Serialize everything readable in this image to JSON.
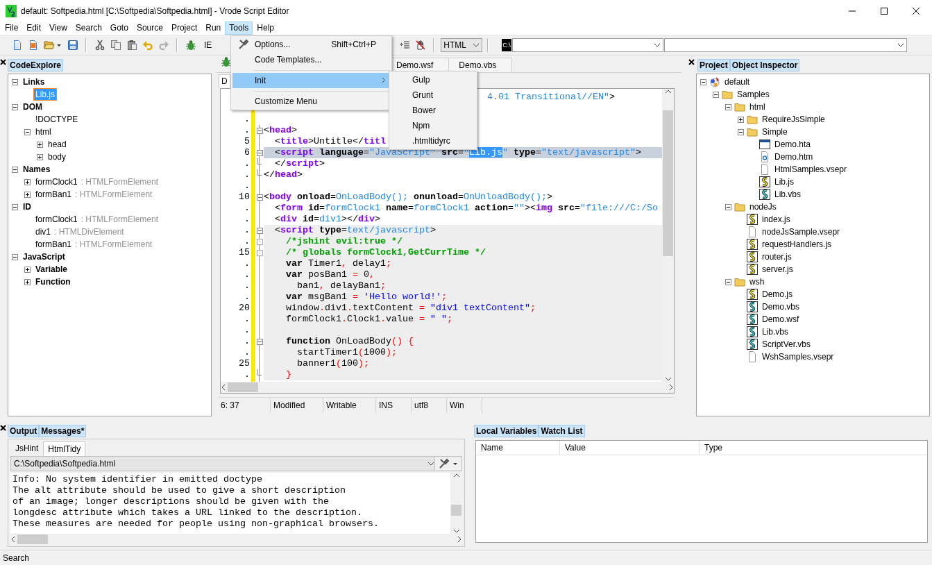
{
  "window": {
    "title": "default: Softpedia.html [C:\\Softpedia\\Softpedia.html] - Vrode Script Editor"
  },
  "menu_bar": [
    {
      "label": "File",
      "selected": false
    },
    {
      "label": "Edit",
      "selected": false
    },
    {
      "label": "View",
      "selected": false
    },
    {
      "label": "Search",
      "selected": false
    },
    {
      "label": "Goto",
      "selected": false
    },
    {
      "label": "Source",
      "selected": false
    },
    {
      "label": "Project",
      "selected": false
    },
    {
      "label": "Run",
      "selected": false
    },
    {
      "label": "Tools",
      "selected": true
    },
    {
      "label": "Help",
      "selected": false
    }
  ],
  "toolbar": {
    "buttons": [
      {
        "kind": "new"
      },
      {
        "kind": "template"
      },
      {
        "kind": "open",
        "dropdown": true
      },
      {
        "kind": "save"
      },
      {
        "kind": "separator"
      },
      {
        "kind": "cut"
      },
      {
        "kind": "copy"
      },
      {
        "kind": "paste"
      },
      {
        "kind": "undo",
        "disabled": false
      },
      {
        "kind": "redo",
        "disabled": true
      },
      {
        "kind": "separator"
      },
      {
        "kind": "debug"
      },
      {
        "kind": "label",
        "text": "IE"
      }
    ],
    "buttons_after_menu": [
      {
        "kind": "lines"
      },
      {
        "kind": "stop"
      },
      {
        "kind": "separator"
      }
    ],
    "language": "HTML",
    "console_label": "C:\\"
  },
  "tools_menu": {
    "items": [
      {
        "kind": "item",
        "label": "Options...",
        "shortcut": "Shift+Ctrl+P",
        "selected": false
      },
      {
        "kind": "item",
        "label": "Code Templates...",
        "selected": false
      },
      {
        "kind": "separator"
      },
      {
        "kind": "submenu",
        "label": "Init",
        "selected": true
      },
      {
        "kind": "separator"
      },
      {
        "kind": "item",
        "label": "Customize Menu",
        "selected": false
      }
    ],
    "submenu": [
      "Gulp",
      "Grunt",
      "Bower",
      "Npm",
      ".htmltidyrc"
    ]
  },
  "code_explorer": {
    "tab": "CodeExplore",
    "tree": [
      {
        "label": "Links",
        "bold": true,
        "expanded": true,
        "selected": false,
        "children": [
          {
            "label": "Lib.js",
            "bold": false,
            "selected": true
          }
        ]
      },
      {
        "label": "DOM",
        "bold": true,
        "expanded": true,
        "selected": false,
        "children": [
          {
            "label": "!DOCTYPE",
            "bold": false,
            "selected": false
          },
          {
            "label": "html",
            "bold": false,
            "expanded": true,
            "selected": false,
            "children": [
              {
                "label": "head",
                "bold": false,
                "expanded": false,
                "selected": false
              },
              {
                "label": "body",
                "bold": false,
                "expanded": false,
                "selected": false
              }
            ]
          }
        ]
      },
      {
        "label": "Names",
        "bold": true,
        "expanded": true,
        "selected": false,
        "children": [
          {
            "label": "formClock1",
            "type": ": HTMLFormElement",
            "bold": false,
            "expanded": false,
            "selected": false
          },
          {
            "label": "formBan1",
            "type": ": HTMLFormElement",
            "bold": false,
            "expanded": false,
            "selected": false
          }
        ]
      },
      {
        "label": "ID",
        "bold": true,
        "expanded": true,
        "selected": false,
        "children": [
          {
            "label": "formClock1",
            "type": ": HTMLFormElement",
            "bold": false,
            "selected": false
          },
          {
            "label": "div1",
            "type": ": HTMLDivElement",
            "bold": false,
            "selected": false
          },
          {
            "label": "formBan1",
            "type": ": HTMLFormElement",
            "bold": false,
            "selected": false
          }
        ]
      },
      {
        "label": "JavaScript",
        "bold": true,
        "expanded": true,
        "selected": false,
        "children": [
          {
            "label": "Variable",
            "bold": true,
            "expanded": false,
            "selected": false
          },
          {
            "label": "Function",
            "bold": true,
            "expanded": false,
            "selected": false
          }
        ]
      }
    ]
  },
  "editor": {
    "tabs": [
      {
        "label": "Demo.wsf"
      },
      {
        "label": "Demo.vbs"
      }
    ],
    "inner_tab": "D",
    "lines": [
      {
        "kind": "plain",
        "covered": true,
        "tokens": [
          {
            "kind": "value",
            "text": "4.01 Transitional//EN\""
          },
          {
            "kind": "punct",
            "text": ">"
          }
        ]
      },
      {
        "kind": "plain"
      },
      {
        "num": ".",
        "kind": "plain"
      },
      {
        "num": ".",
        "kind": "fold",
        "tokens": [
          {
            "kind": "punct",
            "text": "<"
          },
          {
            "kind": "tag",
            "text": "head"
          },
          {
            "kind": "punct",
            "text": ">"
          }
        ]
      },
      {
        "num": "5",
        "kind": "plain",
        "tokens": [
          {
            "kind": "punct",
            "text": "  <"
          },
          {
            "kind": "tag",
            "text": "title"
          },
          {
            "kind": "punct",
            "text": ">"
          },
          {
            "kind": "text",
            "text": "Untitle"
          },
          {
            "kind": "punct",
            "text": "</"
          },
          {
            "kind": "tag",
            "text": "titl"
          }
        ]
      },
      {
        "num": "6",
        "kind": "fold",
        "current": true,
        "tokens": [
          {
            "kind": "punct",
            "text": "  <"
          },
          {
            "kind": "tag",
            "text": "script"
          },
          {
            "kind": "attr",
            "text": " language"
          },
          {
            "kind": "punct",
            "text": "="
          },
          {
            "kind": "value",
            "text": "\"JavaScript\""
          },
          {
            "kind": "attr",
            "text": " src"
          },
          {
            "kind": "punct",
            "text": "="
          },
          {
            "kind": "value",
            "text": "\""
          },
          {
            "kind": "sel",
            "text": "Lib.js"
          },
          {
            "kind": "value",
            "text": "\""
          },
          {
            "kind": "attr",
            "text": " type"
          },
          {
            "kind": "punct",
            "text": "="
          },
          {
            "kind": "value",
            "text": "\"text/javascript\""
          },
          {
            "kind": "punct",
            "text": ">"
          }
        ]
      },
      {
        "num": ".",
        "kind": "end",
        "tokens": [
          {
            "kind": "punct",
            "text": "  </"
          },
          {
            "kind": "tag",
            "text": "script"
          },
          {
            "kind": "punct",
            "text": ">"
          }
        ]
      },
      {
        "num": ".",
        "kind": "end",
        "tokens": [
          {
            "kind": "punct",
            "text": "</"
          },
          {
            "kind": "tag",
            "text": "head"
          },
          {
            "kind": "punct",
            "text": ">"
          }
        ]
      },
      {
        "num": ".",
        "kind": "plain"
      },
      {
        "num": "10",
        "kind": "fold",
        "tokens": [
          {
            "kind": "punct",
            "text": "<"
          },
          {
            "kind": "tag",
            "text": "body"
          },
          {
            "kind": "attr",
            "text": " onload"
          },
          {
            "kind": "punct",
            "text": "="
          },
          {
            "kind": "value",
            "text": "OnLoadBody();"
          },
          {
            "kind": "attr",
            "text": " onunload"
          },
          {
            "kind": "punct",
            "text": "="
          },
          {
            "kind": "value",
            "text": "OnUnloadBody();"
          },
          {
            "kind": "punct",
            "text": ">"
          }
        ]
      },
      {
        "num": ".",
        "kind": "plain",
        "tokens": [
          {
            "kind": "punct",
            "text": "  <"
          },
          {
            "kind": "tag",
            "text": "form"
          },
          {
            "kind": "attr",
            "text": " id"
          },
          {
            "kind": "punct",
            "text": "="
          },
          {
            "kind": "value",
            "text": "formClock1"
          },
          {
            "kind": "attr",
            "text": " name"
          },
          {
            "kind": "punct",
            "text": "="
          },
          {
            "kind": "value",
            "text": "formClock1"
          },
          {
            "kind": "attr",
            "text": " action"
          },
          {
            "kind": "punct",
            "text": "="
          },
          {
            "kind": "value",
            "text": "\"\""
          },
          {
            "kind": "punct",
            "text": "><"
          },
          {
            "kind": "tag",
            "text": "img"
          },
          {
            "kind": "attr",
            "text": " src"
          },
          {
            "kind": "punct",
            "text": "="
          },
          {
            "kind": "value",
            "text": "\"file:///C:/So"
          }
        ]
      },
      {
        "num": ".",
        "kind": "plain",
        "tokens": [
          {
            "kind": "punct",
            "text": "  <"
          },
          {
            "kind": "tag",
            "text": "div"
          },
          {
            "kind": "attr",
            "text": " id"
          },
          {
            "kind": "punct",
            "text": "="
          },
          {
            "kind": "value",
            "text": "div1"
          },
          {
            "kind": "punct",
            "text": "></"
          },
          {
            "kind": "tag",
            "text": "div"
          },
          {
            "kind": "punct",
            "text": ">"
          }
        ]
      },
      {
        "num": ".",
        "kind": "fold",
        "shade": true,
        "tokens": [
          {
            "kind": "punct",
            "text": "  <"
          },
          {
            "kind": "tag",
            "text": "script"
          },
          {
            "kind": "attr",
            "text": " type"
          },
          {
            "kind": "punct",
            "text": "="
          },
          {
            "kind": "value",
            "text": "text/javascript"
          },
          {
            "kind": "punct",
            "text": ">"
          }
        ]
      },
      {
        "num": ".",
        "kind": "marker",
        "shade": true,
        "tokens": [
          {
            "kind": "comment",
            "text": "    /*jshint evil:true */"
          }
        ]
      },
      {
        "num": "15",
        "kind": "marker",
        "shade": true,
        "tokens": [
          {
            "kind": "comment",
            "text": "    /* globals formClock1,GetCurrTime */"
          }
        ]
      },
      {
        "num": ".",
        "kind": "plain",
        "shade": true,
        "tokens": [
          {
            "kind": "kw",
            "text": "    var"
          },
          {
            "kind": "text",
            "text": " Timer1"
          },
          {
            "kind": "op",
            "text": ","
          },
          {
            "kind": "text",
            "text": " delay1"
          },
          {
            "kind": "op",
            "text": ";"
          }
        ]
      },
      {
        "num": ".",
        "kind": "plain",
        "shade": true,
        "tokens": [
          {
            "kind": "kw",
            "text": "    var"
          },
          {
            "kind": "text",
            "text": " posBan1 "
          },
          {
            "kind": "op",
            "text": "="
          },
          {
            "kind": "text",
            "text": " 0"
          },
          {
            "kind": "op",
            "text": ","
          }
        ]
      },
      {
        "num": ".",
        "kind": "plain",
        "shade": true,
        "tokens": [
          {
            "kind": "text",
            "text": "      ban1"
          },
          {
            "kind": "op",
            "text": ","
          },
          {
            "kind": "text",
            "text": " delayBan1"
          },
          {
            "kind": "op",
            "text": ";"
          }
        ]
      },
      {
        "num": ".",
        "kind": "plain",
        "shade": true,
        "tokens": [
          {
            "kind": "kw",
            "text": "    var"
          },
          {
            "kind": "text",
            "text": " msgBan1 "
          },
          {
            "kind": "op",
            "text": "= "
          },
          {
            "kind": "str",
            "text": "'Hello world!'"
          },
          {
            "kind": "op",
            "text": ";"
          }
        ]
      },
      {
        "num": "20",
        "kind": "plain",
        "shade": true,
        "tokens": [
          {
            "kind": "text",
            "text": "    window"
          },
          {
            "kind": "op",
            "text": "."
          },
          {
            "kind": "text",
            "text": "div1"
          },
          {
            "kind": "op",
            "text": "."
          },
          {
            "kind": "text",
            "text": "textContent "
          },
          {
            "kind": "op",
            "text": "= "
          },
          {
            "kind": "str",
            "text": "\"div1 textContent\""
          },
          {
            "kind": "op",
            "text": ";"
          }
        ]
      },
      {
        "num": ".",
        "kind": "plain",
        "shade": true,
        "tokens": [
          {
            "kind": "text",
            "text": "    formClock1"
          },
          {
            "kind": "op",
            "text": "."
          },
          {
            "kind": "text",
            "text": "Clock1"
          },
          {
            "kind": "op",
            "text": "."
          },
          {
            "kind": "text",
            "text": "value "
          },
          {
            "kind": "op",
            "text": "= "
          },
          {
            "kind": "str",
            "text": "\" \""
          },
          {
            "kind": "op",
            "text": ";"
          }
        ]
      },
      {
        "num": ".",
        "kind": "plain",
        "shade": true
      },
      {
        "num": ".",
        "kind": "fold",
        "shade": true,
        "tokens": [
          {
            "kind": "kw",
            "text": "    function"
          },
          {
            "kind": "text",
            "text": " OnLoadBody"
          },
          {
            "kind": "op",
            "text": "() {"
          }
        ]
      },
      {
        "num": ".",
        "kind": "plain",
        "shade": true,
        "tokens": [
          {
            "kind": "text",
            "text": "      startTimer1"
          },
          {
            "kind": "op",
            "text": "("
          },
          {
            "kind": "text",
            "text": "1000"
          },
          {
            "kind": "op",
            "text": ");"
          }
        ]
      },
      {
        "num": "25",
        "kind": "plain",
        "shade": true,
        "tokens": [
          {
            "kind": "text",
            "text": "      banner1"
          },
          {
            "kind": "op",
            "text": "("
          },
          {
            "kind": "text",
            "text": "100"
          },
          {
            "kind": "op",
            "text": ");"
          }
        ]
      },
      {
        "num": ".",
        "kind": "end",
        "shade": true,
        "tokens": [
          {
            "kind": "op",
            "text": "    }"
          }
        ]
      }
    ],
    "status": [
      "6: 37",
      "Modified",
      "Writable",
      "INS",
      "utf8",
      "Win"
    ]
  },
  "project_panel": {
    "tabs": [
      "Project",
      "Object Inspector"
    ],
    "tree": [
      {
        "label": "default",
        "kind": "project",
        "expanded": true,
        "children": [
          {
            "label": "Samples",
            "kind": "folder",
            "expanded": true,
            "children": [
              {
                "label": "html",
                "kind": "folder",
                "expanded": true,
                "children": [
                  {
                    "label": "RequireJsSimple",
                    "kind": "folder",
                    "expanded": false
                  },
                  {
                    "label": "Simple",
                    "kind": "folder",
                    "expanded": true,
                    "children": [
                      {
                        "label": "Demo.hta",
                        "kind": "hta"
                      },
                      {
                        "label": "Demo.htm",
                        "kind": "htm"
                      },
                      {
                        "label": "HtmlSamples.vsepr",
                        "kind": "file"
                      },
                      {
                        "label": "Lib.js",
                        "kind": "js"
                      },
                      {
                        "label": "Lib.vbs",
                        "kind": "vbs"
                      }
                    ]
                  }
                ]
              },
              {
                "label": "nodeJs",
                "kind": "folder",
                "expanded": true,
                "children": [
                  {
                    "label": "index.js",
                    "kind": "js"
                  },
                  {
                    "label": "nodeJsSample.vsepr",
                    "kind": "file"
                  },
                  {
                    "label": "requestHandlers.js",
                    "kind": "js"
                  },
                  {
                    "label": "router.js",
                    "kind": "js"
                  },
                  {
                    "label": "server.js",
                    "kind": "js"
                  }
                ]
              },
              {
                "label": "wsh",
                "kind": "folder",
                "expanded": true,
                "children": [
                  {
                    "label": "Demo.js",
                    "kind": "js"
                  },
                  {
                    "label": "Demo.vbs",
                    "kind": "vbs"
                  },
                  {
                    "label": "Demo.wsf",
                    "kind": "vbs"
                  },
                  {
                    "label": "Lib.vbs",
                    "kind": "vbs"
                  },
                  {
                    "label": "ScriptVer.vbs",
                    "kind": "vbs"
                  },
                  {
                    "label": "WshSamples.vsepr",
                    "kind": "file"
                  }
                ]
              }
            ]
          }
        ]
      }
    ]
  },
  "messages_panel": {
    "tabs": [
      "Output",
      "Messages*"
    ],
    "subtabs": [
      {
        "label": "JsHint",
        "selected": false
      },
      {
        "label": "HtmlTidy",
        "selected": true
      }
    ],
    "file": "C:\\Softpedia\\Softpedia.html",
    "lines": [
      "Info: No system identifier in emitted doctype",
      "The alt attribute should be used to give a short description",
      "of an image; longer descriptions should be given with the",
      "longdesc attribute which takes a URL linked to the description.",
      "These measures are needed for people using non-graphical browsers."
    ]
  },
  "variables_panel": {
    "tabs": [
      "Local Variables",
      "Watch List"
    ],
    "columns": [
      "Name",
      "Value",
      "Type"
    ]
  },
  "status_bar": "Search"
}
